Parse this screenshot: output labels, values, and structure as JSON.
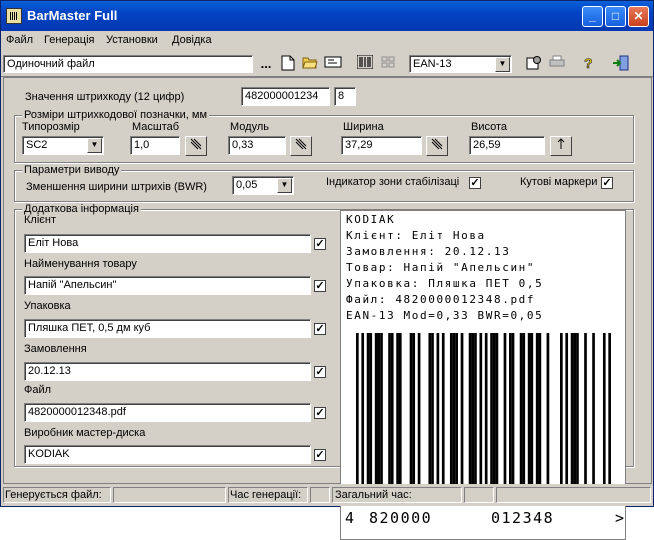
{
  "window": {
    "title": "BarMaster Full",
    "btn_min": "_",
    "btn_max": "□",
    "btn_close": "✕"
  },
  "menu": [
    "Файл",
    "Генерація",
    "Установки",
    "Довідка"
  ],
  "toolbar": {
    "mode_value": "Одиночний файл",
    "ellipsis": "...",
    "symbology_value": "EAN-13",
    "arrow": "▼"
  },
  "barcode_value": {
    "label": "Значення штрихкоду (12 цифр)",
    "value": "482000001234",
    "check_digit": "8"
  },
  "dimensions": {
    "title": "Розміри штрихкодової позначки, мм",
    "size_label": "Типорозмір",
    "size_value": "SC2",
    "scale_label": "Масштаб",
    "scale_value": "1,0",
    "module_label": "Модуль",
    "module_value": "0,33",
    "width_label": "Ширина",
    "width_value": "37,29",
    "height_label": "Висота",
    "height_value": "26,59"
  },
  "output": {
    "title": "Параметри виводу",
    "bwr_label": "Зменшення ширини штрихів (BWR)",
    "bwr_value": "0,05",
    "quiet_zone_label": "Індикатор зони стабілізаці",
    "corner_markers_label": "Кутові маркери"
  },
  "extra": {
    "title": "Додаткова інформація",
    "fields": [
      {
        "label": "Клієнт",
        "value": "Еліт Нова"
      },
      {
        "label": "Найменування товару",
        "value": "Напій \"Апельсин\""
      },
      {
        "label": "Упаковка",
        "value": "Пляшка ПЕТ, 0,5 дм куб"
      },
      {
        "label": "Замовлення",
        "value": "20.12.13"
      },
      {
        "label": "Файл",
        "value": "4820000012348.pdf"
      },
      {
        "label": "Виробник мастер-диска",
        "value": "KODIAK"
      }
    ]
  },
  "preview": {
    "lines": [
      "KODIAK",
      "Клієнт: Еліт Нова",
      "Замовлення: 20.12.13",
      "Товар: Напій \"Апельсин\"",
      "Упаковка: Пляшка ПЕТ 0,5",
      "Файл: 4820000012348.pdf",
      "EAN-13 Mod=0,33 BWR=0,05"
    ],
    "digit_first": "4",
    "digits_left": "820000",
    "digits_right": "012348",
    "digit_end": ">"
  },
  "status": {
    "generating_label": "Генерується файл:",
    "gen_time_label": "Час генерації:",
    "total_time_label": "Загальний час:"
  },
  "check_mark": "✓"
}
